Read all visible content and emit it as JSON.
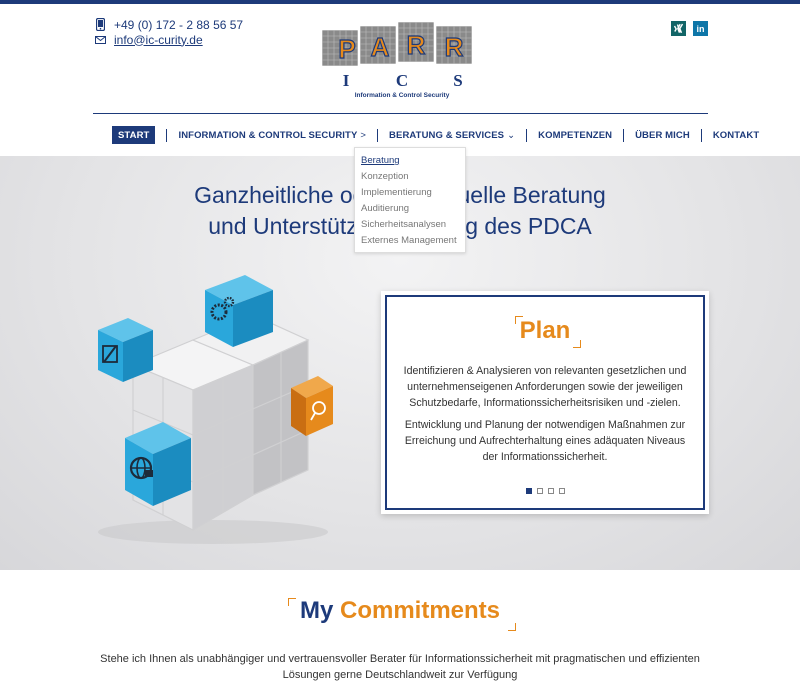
{
  "contact": {
    "phone": "+49 (0) 172 - 2 88 56 57",
    "email": "info@ic-curity.de",
    "phone_icon": "phone-icon",
    "email_icon": "envelope-icon"
  },
  "logo": {
    "letters": [
      "P",
      "A",
      "R",
      "R"
    ],
    "ics": [
      "I",
      "C",
      "S"
    ],
    "tagline": "Information & Control Security"
  },
  "social": [
    {
      "name": "xing",
      "icon": "xing-icon",
      "glyph": "✕",
      "color": "#126567"
    },
    {
      "name": "linkedin",
      "icon": "linkedin-icon",
      "glyph": "in",
      "color": "#0e76a8"
    }
  ],
  "nav": {
    "items": [
      {
        "label": "START",
        "active": true
      },
      {
        "label": "INFORMATION & CONTROL SECURITY",
        "caret": ">"
      },
      {
        "label": "BERATUNG & SERVICES",
        "caret": "⌄"
      },
      {
        "label": "KOMPETENZEN"
      },
      {
        "label": "ÜBER MICH"
      },
      {
        "label": "KONTAKT"
      }
    ]
  },
  "dropdown": {
    "items": [
      "Beratung",
      "Konzeption",
      "Implementierung",
      "Auditierung",
      "Sicherheitsanalysen",
      "Externes Management"
    ]
  },
  "hero": {
    "heading_line1": "Ganzheitliche oder individuelle Beratung",
    "heading_line2": "und Unterstützung entlang des PDCA"
  },
  "slide": {
    "title": "Plan",
    "p1": "Identifizieren & Analysieren von relevanten gesetzlichen und unternehmenseigenen Anforderungen sowie der jeweiligen Schutzbedarfe, Informationssicherheitsrisiken und -zielen.",
    "p2": "Entwicklung und Planung der notwendigen Maßnahmen zur Erreichung und Aufrechterhaltung eines adäquaten Niveaus der Informationssicherheit.",
    "slide_count": 4,
    "active_index": 0
  },
  "commitments": {
    "title_plain": "My",
    "title_accent": "Commitments",
    "text": "Stehe ich Ihnen als unabhängiger und vertrauensvoller Berater für Informationssicherheit mit pragmatischen und effizienten Lösungen gerne Deutschlandweit zur Verfügung"
  },
  "colors": {
    "brand_blue": "#1d3a7a",
    "accent_orange": "#e68a1c",
    "cube_blue": "#2aa7db"
  }
}
